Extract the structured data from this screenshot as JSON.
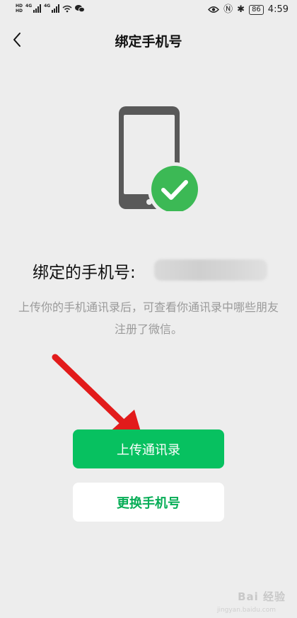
{
  "status_bar": {
    "hd1": "HD",
    "hd2": "HD",
    "net1": "4G",
    "net2": "4G",
    "battery": "86",
    "time": "4:59",
    "icons": [
      "eye-icon",
      "nfc-icon",
      "bluetooth-icon",
      "wifi-icon",
      "wechat-icon"
    ]
  },
  "nav": {
    "title": "绑定手机号",
    "back_icon": "chevron-left-icon"
  },
  "main": {
    "bound_label": "绑定的手机号:",
    "hint": "上传你的手机通讯录后，可查看你通讯录中哪些朋友注册了微信。",
    "primary_button": "上传通讯录",
    "secondary_button": "更换手机号"
  },
  "colors": {
    "accent": "#07c160",
    "check": "#3cb955",
    "arrow": "#e21b1b",
    "phone": "#595959"
  },
  "watermark": {
    "text": "Bai 经验",
    "sub": "jingyan.baidu.com"
  }
}
